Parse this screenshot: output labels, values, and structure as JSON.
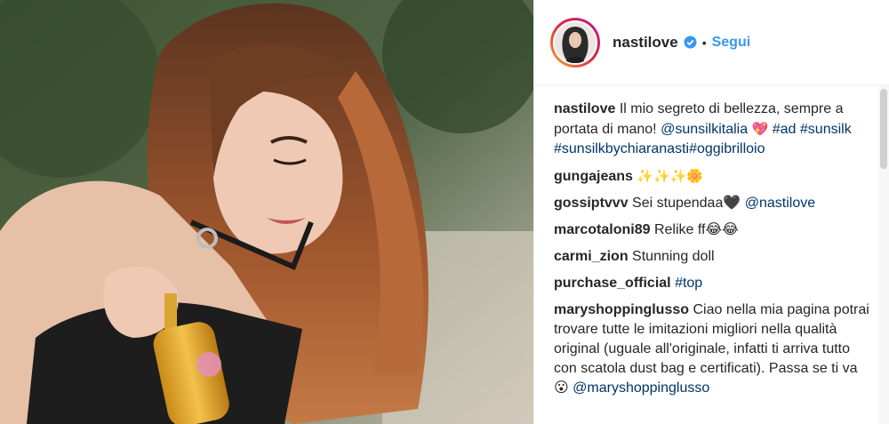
{
  "post": {
    "image_alt": "",
    "author": {
      "username": "nastilove",
      "verified": true,
      "follow_label": "Segui",
      "separator": "•"
    },
    "caption": {
      "author": "nastilove",
      "text": "Il mio segreto di bellezza, sempre a portata di mano!",
      "mention": "@sunsilkitalia",
      "emoji": "💖",
      "hashtags": [
        "#ad",
        "#sunsilk",
        "#sunsilkbychiaranasti",
        "#oggibrilloio"
      ]
    },
    "comments": [
      {
        "author": "gungajeans",
        "text": "✨✨✨🌼"
      },
      {
        "author": "gossiptvvv",
        "text": "Sei stupendaa🖤",
        "mention": "@nastilove"
      },
      {
        "author": "marcotaloni89",
        "text": "Relike ff😂😂"
      },
      {
        "author": "carmi_zion",
        "text": "Stunning doll"
      },
      {
        "author": "purchase_official",
        "hashtag": "#top"
      },
      {
        "author": "maryshoppinglusso",
        "text": "Ciao nella mia pagina potrai trovare tutte le imitazioni migliori nella qualità original (uguale all'originale, infatti ti arriva tutto con scatola dust bag e certificati). Passa se ti va 😮",
        "mention": "@maryshoppinglusso"
      }
    ]
  },
  "colors": {
    "link": "#003569",
    "follow": "#3897f0",
    "text": "#262626",
    "border": "#efefef",
    "verified": "#3897f0"
  },
  "icons": {
    "verified": "verified-badge-icon"
  }
}
